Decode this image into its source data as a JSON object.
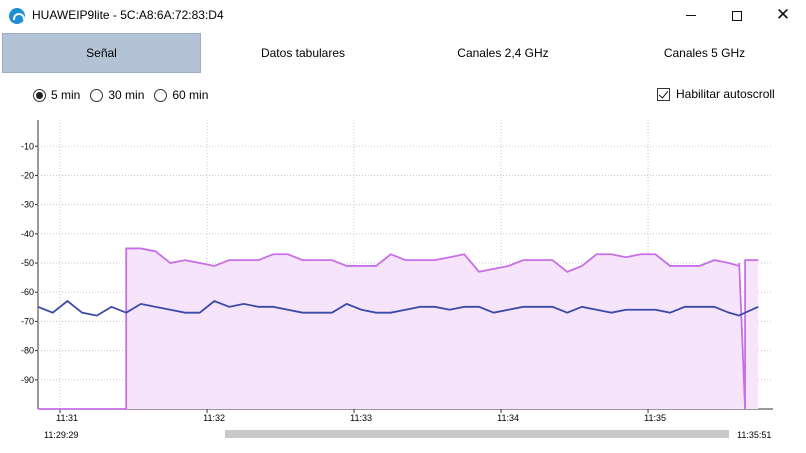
{
  "window": {
    "title": "HUAWEIP9lite - 5C:A8:6A:72:83:D4",
    "icon": "wifi-app-icon",
    "minimize_label": "",
    "maximize_label": "",
    "close_label": "✕"
  },
  "tabs": [
    {
      "label": "Señal",
      "active": true
    },
    {
      "label": "Datos tabulares",
      "active": false
    },
    {
      "label": "Canales 2,4 GHz",
      "active": false
    },
    {
      "label": "Canales 5 GHz",
      "active": false
    }
  ],
  "range_options": [
    {
      "label": "5 min",
      "checked": true
    },
    {
      "label": "30 min",
      "checked": false
    },
    {
      "label": "60 min",
      "checked": false
    }
  ],
  "autoscroll": {
    "label": "Habilitar autoscroll",
    "checked": true
  },
  "timeline": {
    "start": "11:29:29",
    "end": "11:35:51"
  },
  "colors": {
    "series_violet": "#c86fe8",
    "series_blue": "#3b4aa8",
    "fill_violet": "#f6e4fb",
    "active_tab": "#b3c2d4"
  },
  "chart_data": {
    "type": "line",
    "y_ticks": [
      "-10",
      "-20",
      "-30",
      "-40",
      "-50",
      "-60",
      "-70",
      "-80",
      "-90"
    ],
    "y_values": [
      -10,
      -20,
      -30,
      -40,
      -50,
      -60,
      -70,
      -80,
      -90
    ],
    "ylim": [
      -100,
      -1
    ],
    "x_ticks": [
      "11:31",
      "11:32",
      "11:33",
      "11:34",
      "11:35"
    ],
    "x_tick_minutes": [
      31,
      32,
      33,
      34,
      35
    ],
    "xlim": [
      30.85,
      35.85
    ],
    "grid": true,
    "series": [
      {
        "x": [
          30.85,
          30.95,
          31.05,
          31.15,
          31.25,
          31.35,
          31.45,
          31.45,
          31.55,
          31.65,
          31.75,
          31.85,
          31.95,
          32.05,
          32.15,
          32.25,
          32.35,
          32.45,
          32.55,
          32.65,
          32.75,
          32.85,
          32.95,
          33.05,
          33.15,
          33.25,
          33.35,
          33.45,
          33.55,
          33.65,
          33.75,
          33.85,
          33.95,
          34.05,
          34.15,
          34.25,
          34.35,
          34.45,
          34.55,
          34.65,
          34.75,
          34.85,
          34.95,
          35.05,
          35.15,
          35.25,
          35.35,
          35.45,
          35.55,
          35.62,
          35.62,
          35.66,
          35.66,
          35.75
        ],
        "y": [
          -100,
          -100,
          -100,
          -100,
          -100,
          -100,
          -100,
          -45,
          -45,
          -46,
          -50,
          -49,
          -50,
          -51,
          -49,
          -49,
          -49,
          -47,
          -47,
          -49,
          -49,
          -49,
          -51,
          -51,
          -51,
          -47,
          -49,
          -49,
          -49,
          -48,
          -47,
          -53,
          -52,
          -51,
          -49,
          -49,
          -49,
          -53,
          -51,
          -47,
          -47,
          -48,
          -47,
          -47,
          -51,
          -51,
          -51,
          -49,
          -50,
          -51,
          -50,
          -100,
          -49,
          -49
        ]
      },
      {
        "x": [
          30.85,
          30.95,
          31.05,
          31.15,
          31.25,
          31.35,
          31.45,
          31.55,
          31.65,
          31.75,
          31.85,
          31.95,
          32.05,
          32.15,
          32.25,
          32.35,
          32.45,
          32.55,
          32.65,
          32.75,
          32.85,
          32.95,
          33.05,
          33.15,
          33.25,
          33.35,
          33.45,
          33.55,
          33.65,
          33.75,
          33.85,
          33.95,
          34.05,
          34.15,
          34.25,
          34.35,
          34.45,
          34.55,
          34.65,
          34.75,
          34.85,
          34.95,
          35.05,
          35.15,
          35.25,
          35.35,
          35.45,
          35.55,
          35.62,
          35.66,
          35.75
        ],
        "y": [
          -65,
          -67,
          -63,
          -67,
          -68,
          -65,
          -67,
          -64,
          -65,
          -66,
          -67,
          -67,
          -63,
          -65,
          -64,
          -65,
          -65,
          -66,
          -67,
          -67,
          -67,
          -64,
          -66,
          -67,
          -67,
          -66,
          -65,
          -65,
          -66,
          -65,
          -65,
          -67,
          -66,
          -65,
          -65,
          -65,
          -67,
          -65,
          -66,
          -67,
          -66,
          -66,
          -66,
          -67,
          -65,
          -65,
          -65,
          -67,
          -68,
          -67,
          -65
        ]
      }
    ]
  }
}
